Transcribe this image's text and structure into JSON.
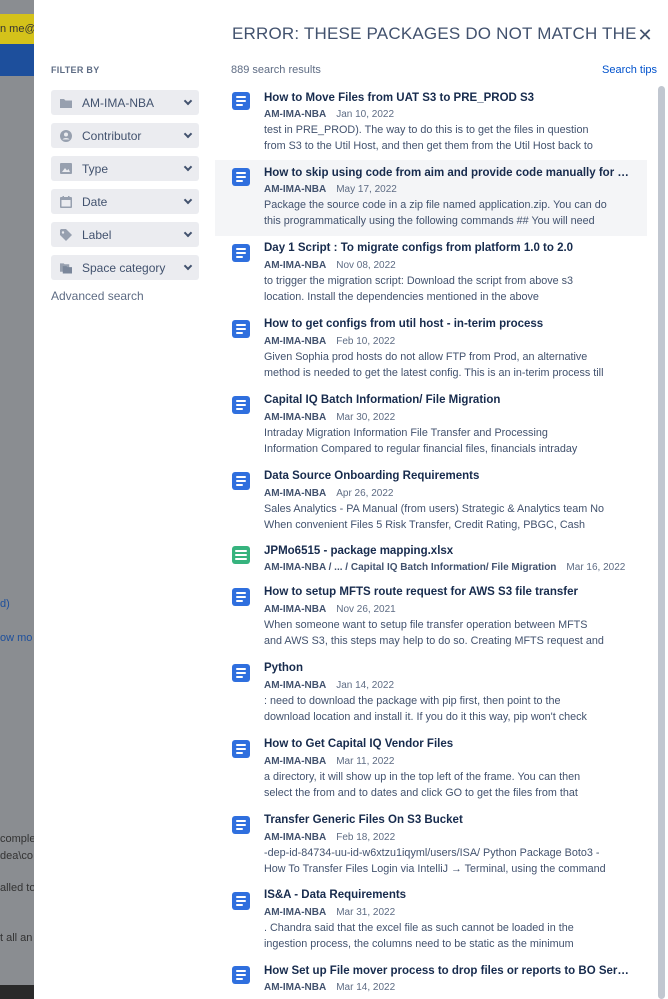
{
  "background": {
    "fragments": [
      "n me@J",
      "d)",
      "ow mo",
      "complet",
      "dea\\co",
      "alled to",
      "t all an"
    ]
  },
  "header": {
    "title": "ERROR: THESE PACKAGES DO NOT MATCH THE HASHES FROM THE REQUIREMENTS FILE",
    "close_symbol": "✕",
    "results_count": "889 search results",
    "search_tips": "Search tips"
  },
  "filters": {
    "title": "FILTER BY",
    "items": [
      {
        "label": "AM-IMA-NBA",
        "icon": "folder-icon"
      },
      {
        "label": "Contributor",
        "icon": "user-icon"
      },
      {
        "label": "Type",
        "icon": "image-icon"
      },
      {
        "label": "Date",
        "icon": "calendar-icon"
      },
      {
        "label": "Label",
        "icon": "tag-icon"
      },
      {
        "label": "Space category",
        "icon": "folders-icon"
      }
    ],
    "advanced": "Advanced search"
  },
  "results": [
    {
      "title": "How to Move Files from UAT S3 to PRE_PROD S3",
      "space": "AM-IMA-NBA",
      "date": "Jan 10, 2022",
      "line1": "test in PRE_PROD). The way to do this is to get the files in question",
      "line2": "from S3 to the Util Host, and then get them from the Util Host back to",
      "icon": "page-icon"
    },
    {
      "title": "How to skip using code from aim and provide code manually for a b…",
      "space": "AM-IMA-NBA",
      "date": "May 17, 2022",
      "line1": "Package the source code in a zip file named application.zip. You can do",
      "line2": "this programmatically using the following commands ## You will need",
      "icon": "page-icon"
    },
    {
      "title": "Day 1 Script : To migrate configs from platform 1.0 to 2.0",
      "space": "AM-IMA-NBA",
      "date": "Nov 08, 2022",
      "line1": "to trigger the migration script: Download the script from above s3",
      "line2": "location.   Install the dependencies mentioned in the above",
      "icon": "page-icon"
    },
    {
      "title": "How to get configs from util host - in-terim process",
      "space": "AM-IMA-NBA",
      "date": "Feb 10, 2022",
      "line1": "Given Sophia prod hosts do not allow FTP from Prod, an alternative",
      "line2": "method is needed to get the latest config. This is an in-terim process till",
      "icon": "page-icon"
    },
    {
      "title": "Capital IQ Batch Information/ File Migration",
      "space": "AM-IMA-NBA",
      "date": "Mar 30, 2022",
      "line1": "Intraday Migration Information  File Transfer and Processing",
      "line2": "Information Compared to regular financial files, financials intraday",
      "icon": "page-icon"
    },
    {
      "title": "Data Source Onboarding Requirements",
      "space": "AM-IMA-NBA",
      "date": "Apr 26, 2022",
      "line1": "Sales Analytics - PA Manual (from users) Strategic & Analytics team No",
      "line2": "When convenient Files 5 Risk Transfer, Credit Rating, PBGC, Cash",
      "icon": "page-icon"
    },
    {
      "title": "JPMo6515 - package mapping.xlsx",
      "space": "AM-IMA-NBA / ... / Capital IQ Batch Information/ File Migration",
      "date": "Mar 16, 2022",
      "line1": "",
      "line2": "",
      "icon": "spreadsheet-icon"
    },
    {
      "title": "How to setup MFTS route request for AWS S3 file transfer",
      "space": "AM-IMA-NBA",
      "date": "Nov 26, 2021",
      "line1": "When someone want to setup file transfer operation between MFTS",
      "line2": "and AWS S3, this steps may help to do so. Creating MFTS request and",
      "icon": "page-icon"
    },
    {
      "title": "Python",
      "space": "AM-IMA-NBA",
      "date": "Jan 14, 2022",
      "line1": ": need to download the package with pip first, then point to the",
      "line2": "download location and install it. If you do it this way, pip won't check",
      "icon": "page-icon"
    },
    {
      "title": "How to Get Capital IQ Vendor Files",
      "space": "AM-IMA-NBA",
      "date": "Mar 11, 2022",
      "line1": "a directory, it will show up in the top left of the frame. You can then",
      "line2": "select the from and to dates and click GO to get the files from that",
      "icon": "page-icon"
    },
    {
      "title": "Transfer Generic Files On S3 Bucket",
      "space": "AM-IMA-NBA",
      "date": "Feb 18, 2022",
      "line1": "-dep-id-84734-uu-id-w6xtzu1iqyml/users/ISA/ Python Package Boto3 -",
      "line2": "How To Transfer Files Login via IntelliJ → Terminal, using the command",
      "icon": "page-icon"
    },
    {
      "title": "IS&A - Data Requirements",
      "space": "AM-IMA-NBA",
      "date": "Mar 31, 2022",
      "line1": ". Chandra said that the excel file as such cannot be loaded in the",
      "line2": "ingestion process, the columns need to be static as the minimum",
      "icon": "page-icon"
    },
    {
      "title": "How Set up File mover process to drop files or reports to BO Server …",
      "space": "AM-IMA-NBA",
      "date": "Mar 14, 2022",
      "line1": "",
      "line2": "",
      "icon": "page-icon"
    }
  ]
}
